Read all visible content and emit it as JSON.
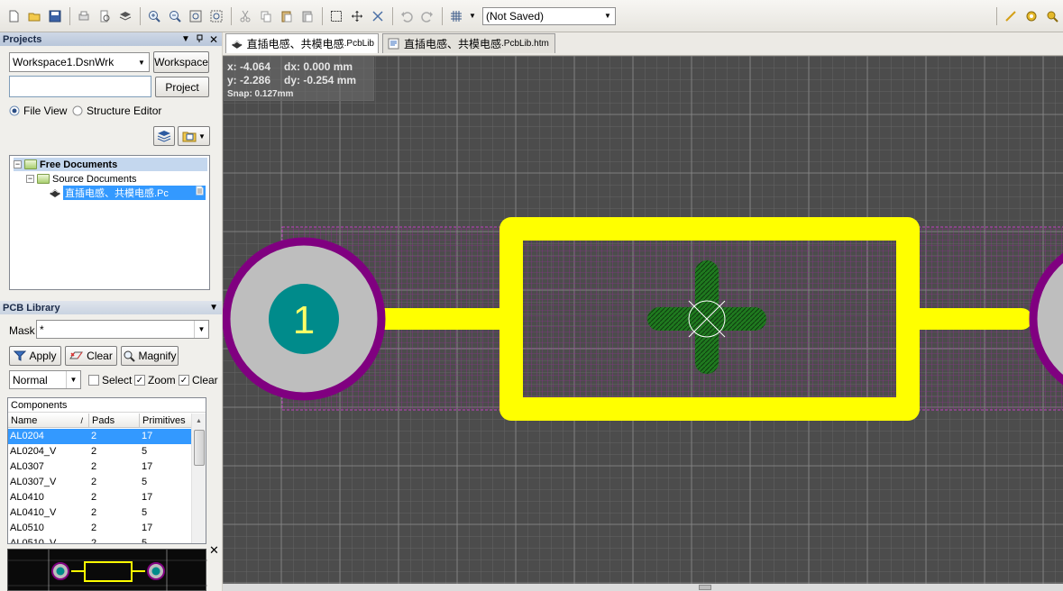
{
  "toolbar": {
    "doc_status": "(Not Saved)"
  },
  "projects_panel": {
    "title": "Projects",
    "workspace_combo": "Workspace1.DsnWrk",
    "workspace_button": "Workspace",
    "project_button": "Project",
    "radio_file_view": "File View",
    "radio_structure_editor": "Structure Editor",
    "tree": {
      "root": "Free Documents",
      "folder": "Source Documents",
      "file": "直插电感、共模电感.Pc"
    }
  },
  "pcb_library": {
    "title": "PCB Library",
    "mask_label": "Mask",
    "mask_value": "*",
    "apply_button": "Apply",
    "clear_button": "Clear",
    "magnify_button": "Magnify",
    "mode_select": "Normal",
    "check_select": "Select",
    "check_zoom": "Zoom",
    "check_clear": "Clear E",
    "components_header": "Components",
    "columns": [
      "Name",
      "Pads",
      "Primitives"
    ],
    "rows": [
      {
        "name": "AL0204",
        "pads": "2",
        "primitives": "17"
      },
      {
        "name": "AL0204_V",
        "pads": "2",
        "primitives": "5"
      },
      {
        "name": "AL0307",
        "pads": "2",
        "primitives": "17"
      },
      {
        "name": "AL0307_V",
        "pads": "2",
        "primitives": "5"
      },
      {
        "name": "AL0410",
        "pads": "2",
        "primitives": "17"
      },
      {
        "name": "AL0410_V",
        "pads": "2",
        "primitives": "5"
      },
      {
        "name": "AL0510",
        "pads": "2",
        "primitives": "17"
      },
      {
        "name": "AL0510_V",
        "pads": "2",
        "primitives": "5"
      }
    ]
  },
  "tabs": [
    {
      "label_main": "直插电感、共模电感",
      "label_ext": ".PcbLib"
    },
    {
      "label_main": "直插电感、共模电感",
      "label_ext": ".PcbLib.htm"
    }
  ],
  "coords": {
    "x": "x: -4.064",
    "dx": "dx:  0.000 mm",
    "y": "y: -2.286",
    "dy": "dy: -0.254  mm",
    "snap": "Snap: 0.127mm"
  },
  "canvas": {
    "pad_label": "1",
    "colors": {
      "background": "#4c4c4c",
      "grid": "#6a6a6a",
      "silkscreen": "#ffff00",
      "courtyard": "#a020a0",
      "pad_ring": "#800080",
      "pad_center": "#008b8b",
      "mechanical": "#1f7a1f"
    }
  }
}
